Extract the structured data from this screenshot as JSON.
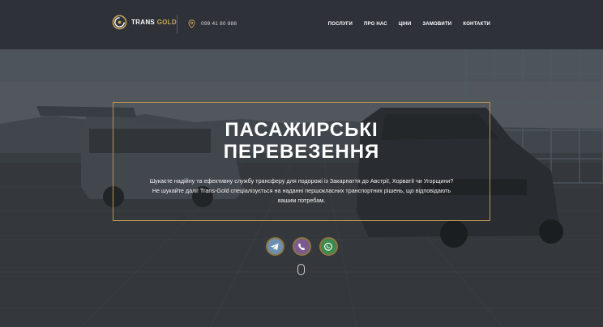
{
  "brand": {
    "name_white": "TRANS",
    "name_gold": "GOLD"
  },
  "phone": {
    "number": "099 41 80 888"
  },
  "nav": {
    "items": [
      {
        "label": "ПОСЛУГИ"
      },
      {
        "label": "ПРО НАС"
      },
      {
        "label": "ЦІНИ"
      },
      {
        "label": "ЗАМОВИТИ"
      },
      {
        "label": "КОНТАКТИ"
      }
    ]
  },
  "hero": {
    "title_line1": "ПАСАЖИРСЬКІ",
    "title_line2": "ПЕРЕВЕЗЕННЯ",
    "desc_line1": "Шукаєте надійну та ефективну службу трансферу для подорожі із Закарпаття до Австрії, Хорватії чи Угорщини?",
    "desc_line2": "Не шукайте далі! Trans-Gold спеціалізується на наданні першокласних транспортних рішень, що відповідають",
    "desc_line3": "вашим потребам."
  },
  "socials": [
    {
      "icon": "telegram-icon",
      "color": "#6f8fb0"
    },
    {
      "icon": "viber-icon",
      "color": "#7b5a8e"
    },
    {
      "icon": "whatsapp-icon",
      "color": "#3c8a4e"
    }
  ],
  "colors": {
    "header_bg": "#2e3138",
    "accent_gold": "#c9a65b",
    "frame_gold": "#b79652"
  }
}
